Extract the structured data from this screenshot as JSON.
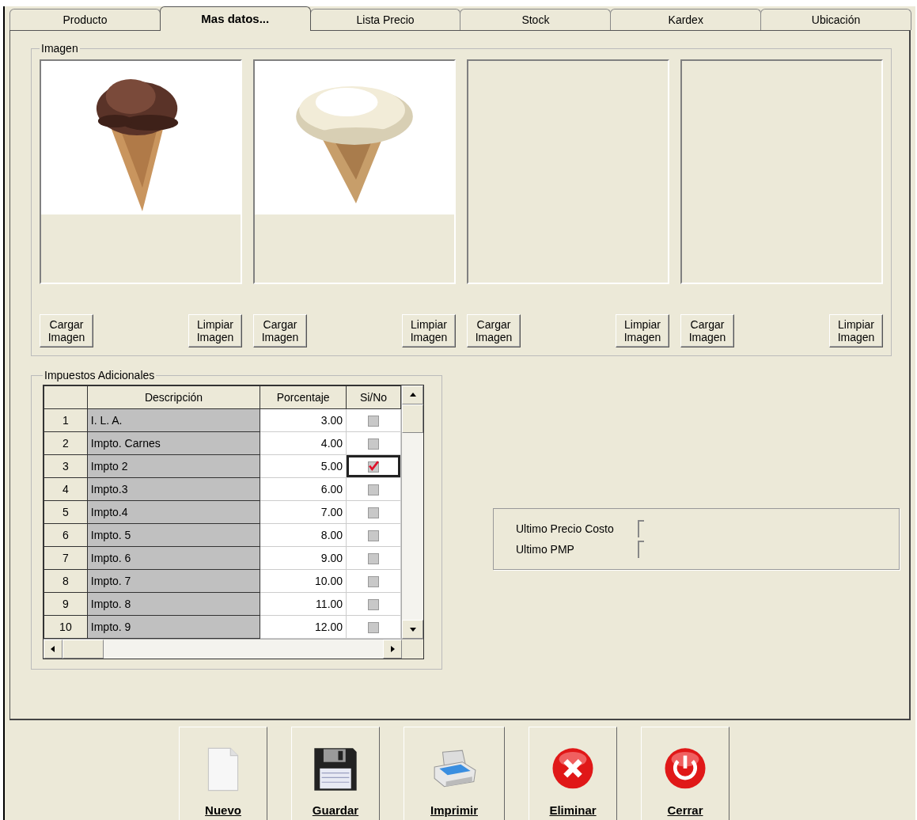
{
  "tabs": [
    {
      "label": "Producto",
      "selected": false
    },
    {
      "label": "Mas datos...",
      "selected": true
    },
    {
      "label": "Lista Precio",
      "selected": false
    },
    {
      "label": "Stock",
      "selected": false
    },
    {
      "label": "Kardex",
      "selected": false
    },
    {
      "label": "Ubicación",
      "selected": false
    }
  ],
  "image_group": {
    "title": "Imagen",
    "slots": [
      {
        "kind": "picture",
        "buttons": [
          "Cargar Imagen",
          "Limpiar Imagen"
        ]
      },
      {
        "kind": "picture",
        "buttons": [
          "Cargar Imagen",
          "Limpiar Imagen"
        ]
      },
      {
        "kind": "empty",
        "buttons": [
          "Cargar Imagen",
          "Limpiar Imagen"
        ]
      },
      {
        "kind": "empty",
        "buttons": [
          "Cargar Imagen",
          "Limpiar Imagen"
        ]
      }
    ]
  },
  "taxes": {
    "title": "Impuestos Adicionales",
    "columns": [
      "Descripción",
      "Porcentaje",
      "Si/No"
    ],
    "rows": [
      {
        "number": "1",
        "description": "I. L. A.",
        "percentage": "3.00",
        "checked": false,
        "focused": false
      },
      {
        "number": "2",
        "description": "Impto. Carnes",
        "percentage": "4.00",
        "checked": false,
        "focused": false
      },
      {
        "number": "3",
        "description": "Impto 2",
        "percentage": "5.00",
        "checked": true,
        "focused": true
      },
      {
        "number": "4",
        "description": "Impto.3",
        "percentage": "6.00",
        "checked": false,
        "focused": false
      },
      {
        "number": "5",
        "description": "Impto.4",
        "percentage": "7.00",
        "checked": false,
        "focused": false
      },
      {
        "number": "6",
        "description": "Impto. 5",
        "percentage": "8.00",
        "checked": false,
        "focused": false
      },
      {
        "number": "7",
        "description": "Impto. 6",
        "percentage": "9.00",
        "checked": false,
        "focused": false
      },
      {
        "number": "8",
        "description": "Impto. 7",
        "percentage": "10.00",
        "checked": false,
        "focused": false
      },
      {
        "number": "9",
        "description": "Impto. 8",
        "percentage": "11.00",
        "checked": false,
        "focused": false
      },
      {
        "number": "10",
        "description": "Impto. 9",
        "percentage": "12.00",
        "checked": false,
        "focused": false
      }
    ]
  },
  "costs": [
    {
      "label": "Ultimo Precio Costo"
    },
    {
      "label": "Ultimo PMP"
    }
  ],
  "actions": [
    {
      "kind": "new",
      "label": "Nuevo"
    },
    {
      "kind": "save",
      "label": "Guardar"
    },
    {
      "kind": "print",
      "label": "Imprimir"
    },
    {
      "kind": "delete",
      "label": "Eliminar"
    },
    {
      "kind": "close",
      "label": "Cerrar"
    }
  ]
}
